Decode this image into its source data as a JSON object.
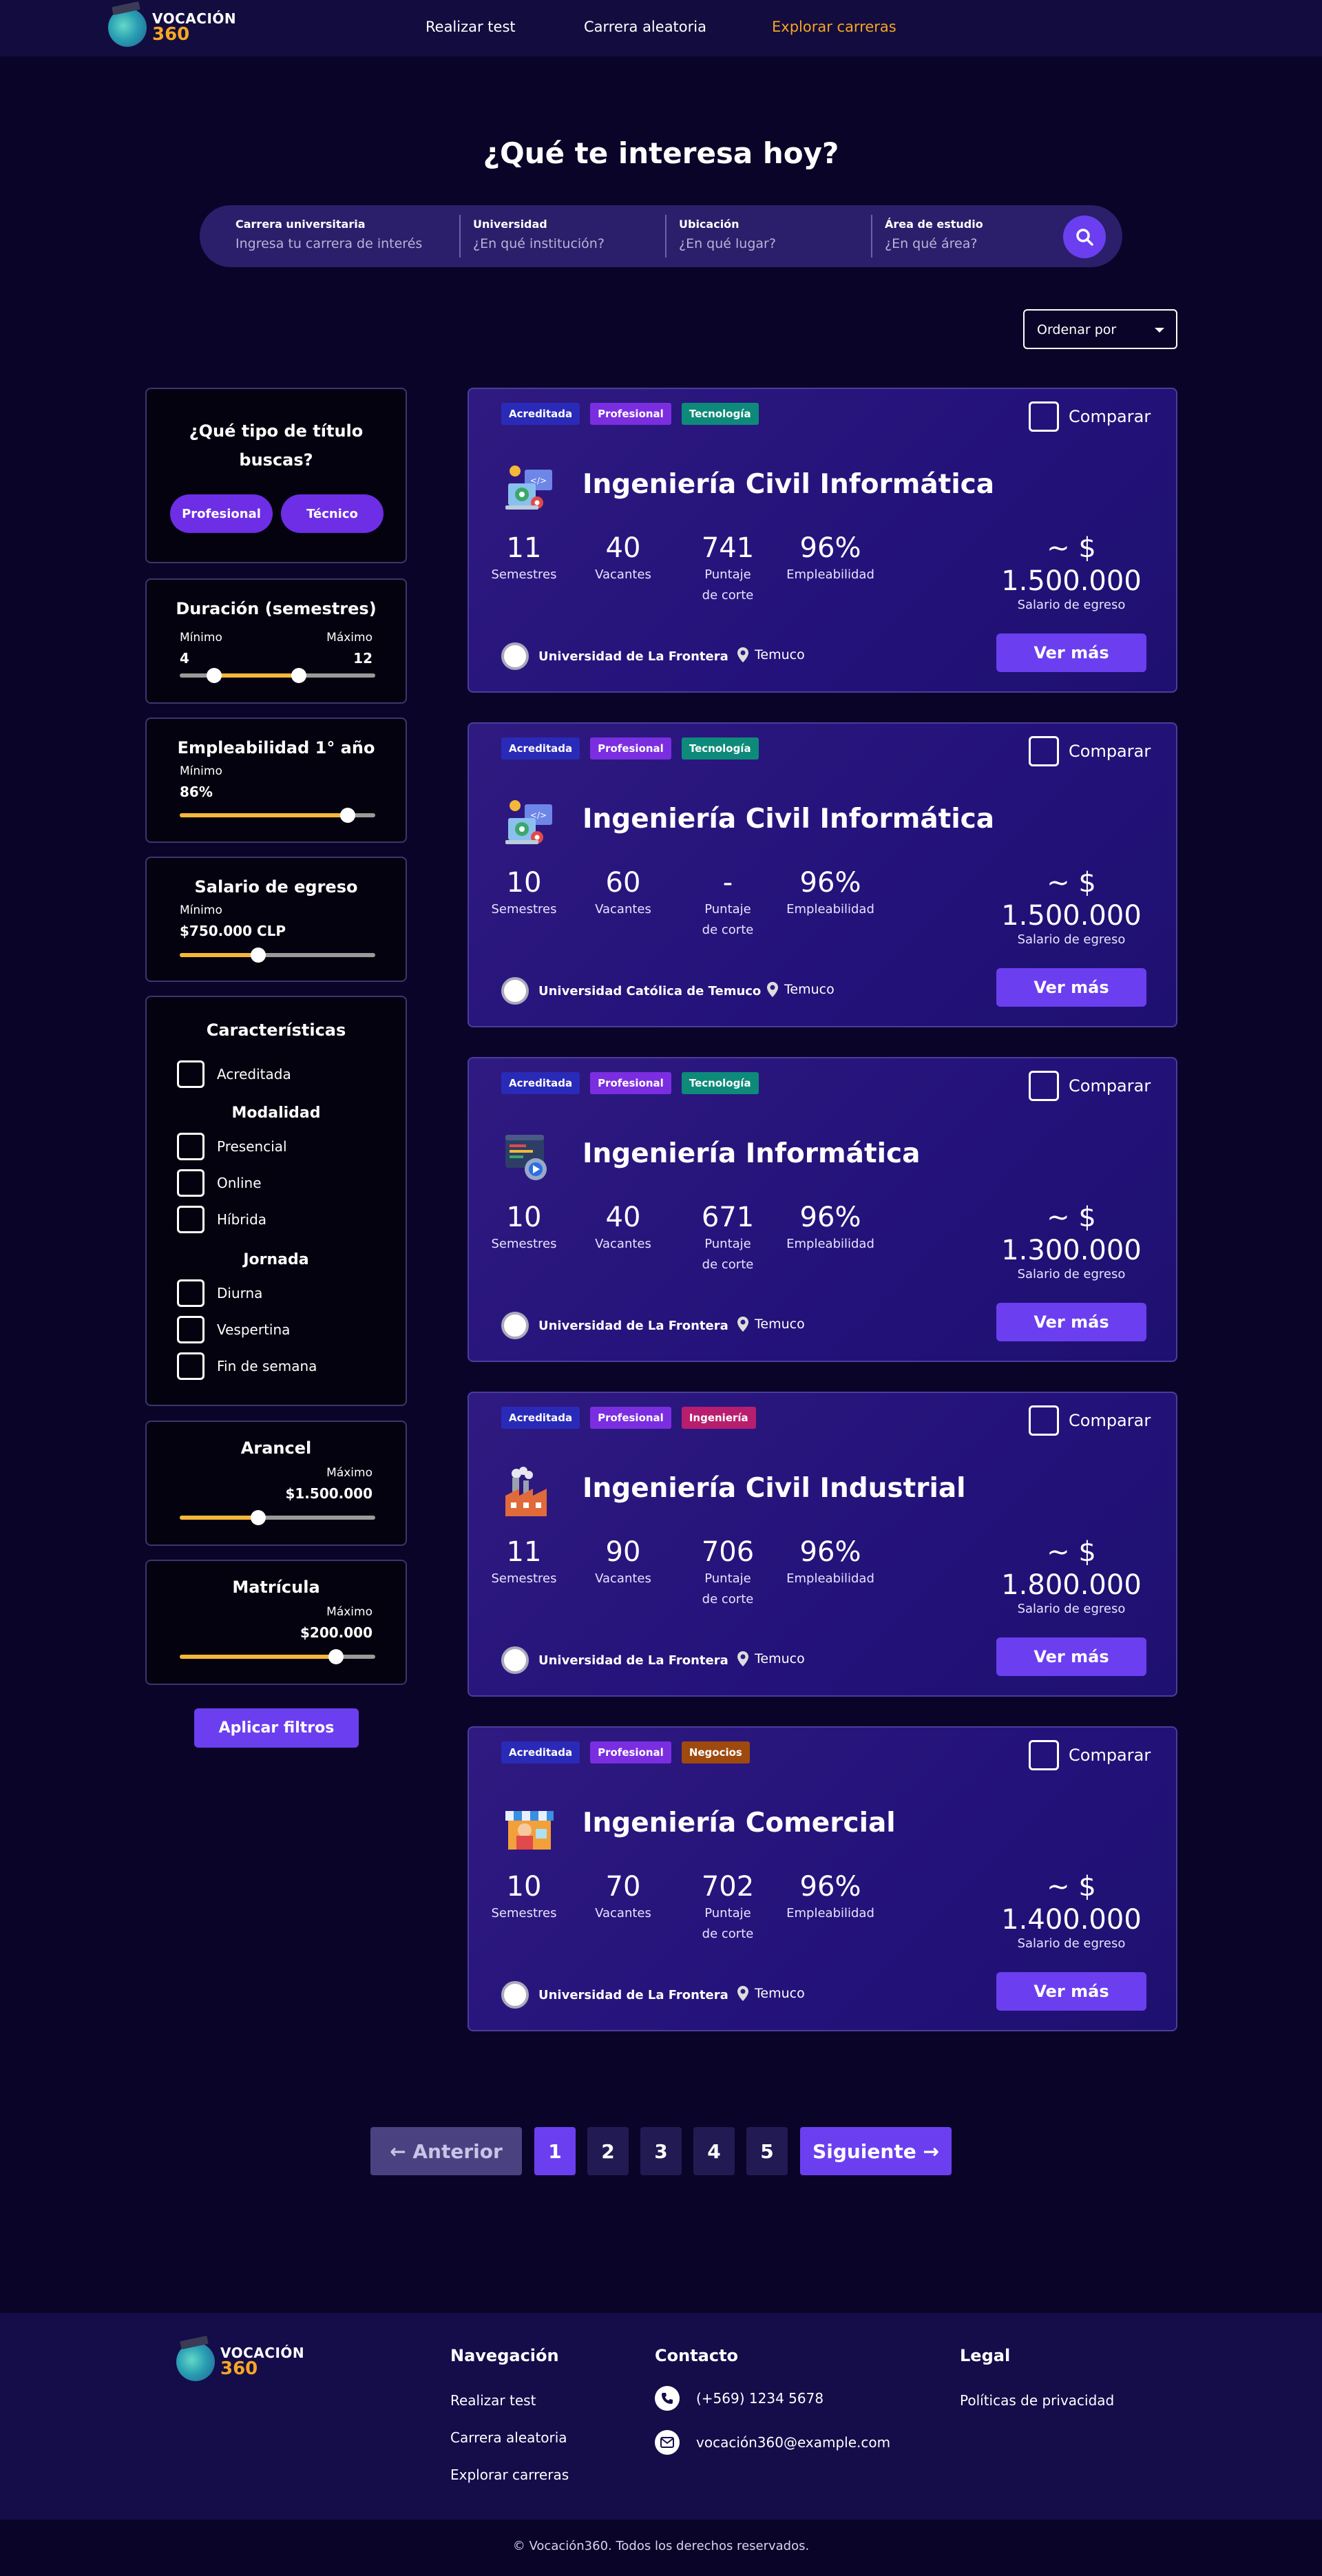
{
  "brand": {
    "line1": "VOCACIÓN",
    "line2": "360"
  },
  "nav": {
    "test": "Realizar test",
    "random": "Carrera aleatoria",
    "explore": "Explorar carreras"
  },
  "colors": {
    "accent": "#6b3ff0",
    "highlight": "#f5a623",
    "background": "#0a0528"
  },
  "page_title": "¿Qué te interesa hoy?",
  "search": {
    "career_label": "Carrera universitaria",
    "career_placeholder": "Ingresa tu carrera de interés",
    "uni_label": "Universidad",
    "uni_placeholder": "¿En qué institución?",
    "loc_label": "Ubicación",
    "loc_placeholder": "¿En qué lugar?",
    "area_label": "Área de estudio",
    "area_placeholder": "¿En qué área?",
    "button_icon": "search-icon"
  },
  "sort": {
    "label": "Ordenar por"
  },
  "filters": {
    "title_type": {
      "heading": "¿Qué tipo de título buscas?",
      "options": [
        "Profesional",
        "Técnico"
      ]
    },
    "duration": {
      "heading": "Duración (semestres)",
      "min_label": "Mínimo",
      "max_label": "Máximo",
      "min": "4",
      "max": "12",
      "range_min": 0,
      "range_max": 20
    },
    "employability": {
      "heading": "Empleabilidad 1° año",
      "min_label": "Mínimo",
      "value": "86%",
      "fraction": 0.86
    },
    "salary": {
      "heading": "Salario de egreso",
      "min_label": "Mínimo",
      "value": "$750.000 CLP",
      "fraction": 0.4
    },
    "features": {
      "heading": "Características",
      "accredited": "Acreditada",
      "modality_heading": "Modalidad",
      "modality": [
        "Presencial",
        "Online",
        "Híbrida"
      ],
      "schedule_heading": "Jornada",
      "schedule": [
        "Diurna",
        "Vespertina",
        "Fin de semana"
      ]
    },
    "tuition": {
      "heading": "Arancel",
      "max_label": "Máximo",
      "value": "$1.500.000",
      "fraction": 0.4
    },
    "enrollment": {
      "heading": "Matrícula",
      "max_label": "Máximo",
      "value": "$200.000",
      "fraction": 0.8
    },
    "apply": "Aplicar filtros"
  },
  "stat_labels": {
    "semesters": "Semestres",
    "vacancies": "Vacantes",
    "score": "Puntaje de corte",
    "employability": "Empleabilidad",
    "salary": "Salario de egreso"
  },
  "compare_label": "Comparar",
  "more_label": "Ver más",
  "cards": [
    {
      "tags": [
        "Acreditada",
        "Profesional",
        "Tecnología"
      ],
      "title": "Ingeniería Civil Informática",
      "icon": "computer-gear-icon",
      "semesters": "11",
      "vacancies": "40",
      "score": "741",
      "employability": "96%",
      "salary": "~ $ 1.500.000",
      "university": "Universidad de La Frontera",
      "location": "Temuco"
    },
    {
      "tags": [
        "Acreditada",
        "Profesional",
        "Tecnología"
      ],
      "title": "Ingeniería Civil Informática",
      "icon": "computer-gear-icon",
      "semesters": "10",
      "vacancies": "60",
      "score": "-",
      "employability": "96%",
      "salary": "~ $ 1.500.000",
      "university": "Universidad Católica de Temuco",
      "location": "Temuco"
    },
    {
      "tags": [
        "Acreditada",
        "Profesional",
        "Tecnología"
      ],
      "title": "Ingeniería Informática",
      "icon": "code-window-icon",
      "semesters": "10",
      "vacancies": "40",
      "score": "671",
      "employability": "96%",
      "salary": "~ $ 1.300.000",
      "university": "Universidad de La Frontera",
      "location": "Temuco"
    },
    {
      "tags": [
        "Acreditada",
        "Profesional",
        "Ingeniería"
      ],
      "title": "Ingeniería Civil Industrial",
      "icon": "factory-icon",
      "semesters": "11",
      "vacancies": "90",
      "score": "706",
      "employability": "96%",
      "salary": "~ $ 1.800.000",
      "university": "Universidad de La Frontera",
      "location": "Temuco"
    },
    {
      "tags": [
        "Acreditada",
        "Profesional",
        "Negocios"
      ],
      "title": "Ingeniería Comercial",
      "icon": "shop-icon",
      "semesters": "10",
      "vacancies": "70",
      "score": "702",
      "employability": "96%",
      "salary": "~ $ 1.400.000",
      "university": "Universidad de La Frontera",
      "location": "Temuco"
    }
  ],
  "pagination": {
    "prev": "← Anterior",
    "pages": [
      "1",
      "2",
      "3",
      "4",
      "5"
    ],
    "current": "1",
    "next": "Siguiente →"
  },
  "footer": {
    "nav_heading": "Navegación",
    "nav_links": [
      "Realizar test",
      "Carrera aleatoria",
      "Explorar carreras"
    ],
    "contact_heading": "Contacto",
    "phone": "(+569) 1234 5678",
    "email": "vocación360@example.com",
    "legal_heading": "Legal",
    "privacy": "Políticas de privacidad",
    "copyright": "© Vocación360. Todos los derechos reservados."
  }
}
